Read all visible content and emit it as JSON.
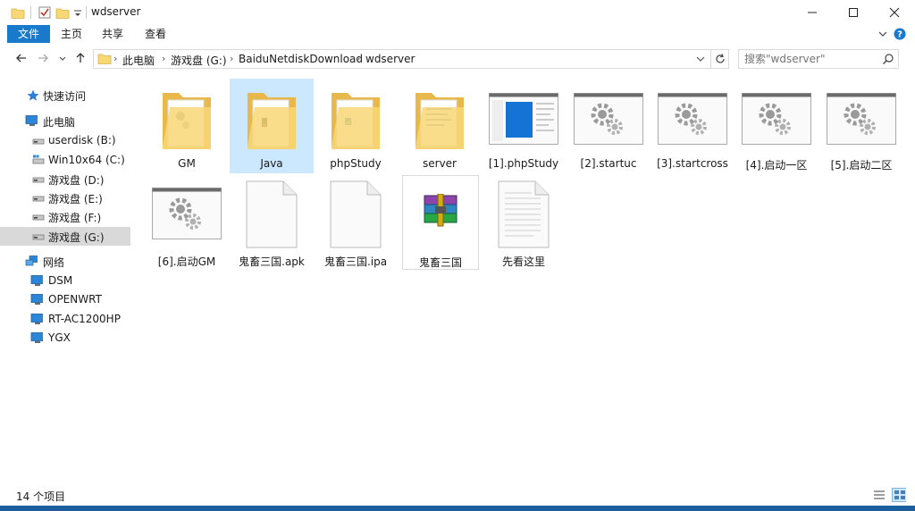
{
  "window": {
    "title": "wdserver"
  },
  "ribbon": {
    "tabs": [
      "文件",
      "主页",
      "共享",
      "查看"
    ]
  },
  "address": {
    "crumbs": [
      "此电脑",
      "游戏盘 (G:)",
      "BaiduNetdiskDownload",
      "wdserver"
    ]
  },
  "search": {
    "placeholder": "搜索\"wdserver\""
  },
  "sidebar": {
    "items": [
      {
        "label": "快速访问",
        "icon": "star-icon"
      },
      {
        "label": "此电脑",
        "icon": "computer-icon"
      },
      {
        "label": "userdisk (B:)",
        "icon": "drive-icon"
      },
      {
        "label": "Win10x64 (C:)",
        "icon": "windows-drive-icon"
      },
      {
        "label": "游戏盘 (D:)",
        "icon": "drive-icon"
      },
      {
        "label": "游戏盘 (E:)",
        "icon": "drive-icon"
      },
      {
        "label": "游戏盘 (F:)",
        "icon": "drive-icon"
      },
      {
        "label": "游戏盘 (G:)",
        "icon": "drive-icon"
      },
      {
        "label": "网络",
        "icon": "network-icon"
      },
      {
        "label": "DSM",
        "icon": "monitor-icon"
      },
      {
        "label": "OPENWRT",
        "icon": "monitor-icon"
      },
      {
        "label": "RT-AC1200HP",
        "icon": "monitor-icon"
      },
      {
        "label": "YGX",
        "icon": "monitor-icon"
      }
    ]
  },
  "files": {
    "items": [
      {
        "name": "GM",
        "type": "folder"
      },
      {
        "name": "Java",
        "type": "folder"
      },
      {
        "name": "phpStudy",
        "type": "folder"
      },
      {
        "name": "server",
        "type": "folder"
      },
      {
        "name": "[1].phpStudy",
        "type": "shortcut"
      },
      {
        "name": "[2].startuc",
        "type": "batch"
      },
      {
        "name": "[3].startcross",
        "type": "batch"
      },
      {
        "name": "[4].启动一区",
        "type": "batch"
      },
      {
        "name": "[5].启动二区",
        "type": "batch"
      },
      {
        "name": "[6].启动GM",
        "type": "batch"
      },
      {
        "name": "鬼畜三国.apk",
        "type": "document"
      },
      {
        "name": "鬼畜三国.ipa",
        "type": "document"
      },
      {
        "name": "鬼畜三国",
        "type": "archive"
      },
      {
        "name": "先看这里",
        "type": "text"
      }
    ]
  },
  "status": {
    "count": "14 个项目"
  },
  "colors": {
    "accent": "#1979ca",
    "selected": "#cce8ff",
    "folder": "#f8d775"
  }
}
